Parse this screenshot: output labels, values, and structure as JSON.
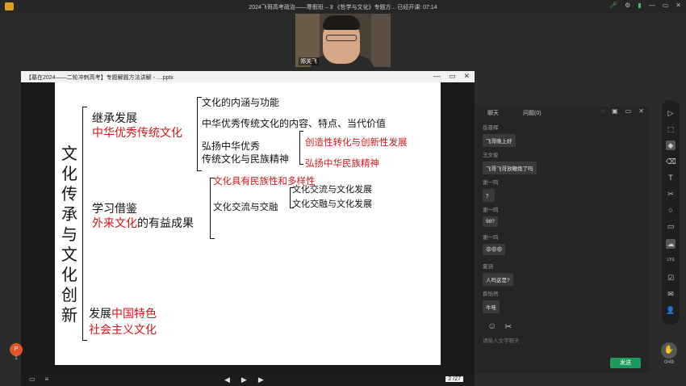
{
  "topbar": {
    "title": "2024飞哥高考政治——寒假班 – 3 《哲学与文化》专题方...  已经开课: 07:14",
    "icons": [
      "mic-icon",
      "settings-icon",
      "signal-icon",
      "minimize-icon",
      "maximize-icon",
      "close-icon"
    ]
  },
  "camera": {
    "name": "郑关飞"
  },
  "ppt": {
    "title": "【墓在2024——二轮冲刺高考】专题解题方法讲解 ◦ ....pptx",
    "window_icons": [
      "—",
      "▭",
      "✕"
    ],
    "page": "2 /27",
    "slide": {
      "vertical_title": [
        "文",
        "化",
        "传",
        "承",
        "与",
        "文",
        "化",
        "创",
        "新"
      ],
      "b1_line1": "继承发展",
      "b1_line2": "中华优秀传统文化",
      "b1_sub1": "文化的内涵与功能",
      "b1_sub2": "中华优秀传统文化的内容、特点、当代价值",
      "b1_sub3_line1": "弘扬中华优秀",
      "b1_sub3_line2": "传统文化与民族精神",
      "b1_sub3_a": "创造性转化与创新性发展",
      "b1_sub3_b": "弘扬中华民族精神",
      "b2_line1": "学习借鉴",
      "b2_line2_red": "外来文化",
      "b2_line2_rest": "的有益成果",
      "b2_sub1": "文化具有民族性和多样性",
      "b2_sub2": "文化交流与交融",
      "b2_sub2_a": "文化交流与文化发展",
      "b2_sub2_b": "文化交融与文化发展",
      "b3_line1_a": "发展",
      "b3_line1_red": "中国特色",
      "b3_line2": "社会主义文化"
    }
  },
  "chat": {
    "tab_chat": "聊天",
    "tab_questions": "问题(0)",
    "messages": [
      {
        "user": "岳晋辉",
        "text": "飞哥晚上好"
      },
      {
        "user": "王文俊",
        "text": "飞哥飞哥放鞭炮了吗"
      },
      {
        "user": "谢一鸣",
        "text": "？"
      },
      {
        "user": "谢一鸣",
        "text": "98?"
      },
      {
        "user": "谢一鸣",
        "text": "😡😡😡"
      },
      {
        "user": "夏涵",
        "text": "人吗这是?"
      },
      {
        "user": "蔡怡然",
        "text": "牛哇"
      }
    ],
    "placeholder": "请输入文字聊天",
    "send": "发送"
  },
  "toolbar": {
    "items": [
      "▷",
      "⬚",
      "◆",
      "⌫",
      "T",
      "✂",
      "○",
      "▭",
      "☁",
      "LYS",
      "☑",
      "✉",
      "👤"
    ]
  },
  "hand": {
    "count": "0/49"
  },
  "pdf": {
    "label": "P",
    "count": "1"
  }
}
